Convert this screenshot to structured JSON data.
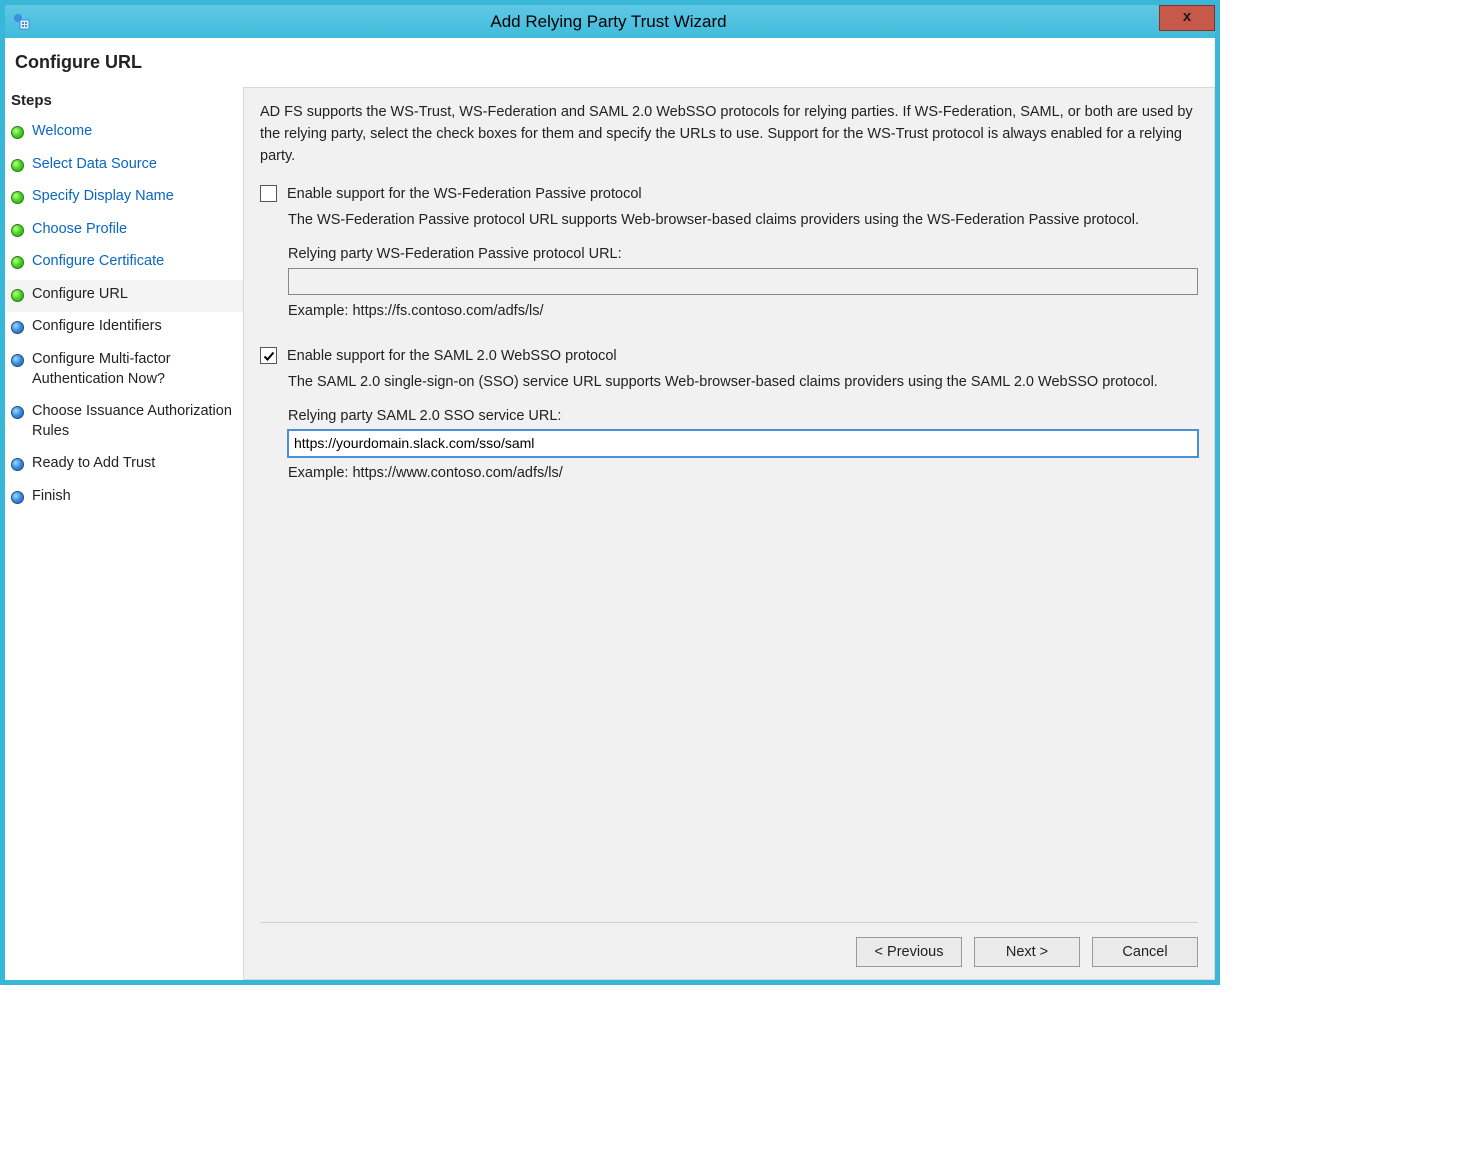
{
  "window": {
    "title": "Add Relying Party Trust Wizard",
    "close_label": "x"
  },
  "page": {
    "title": "Configure URL"
  },
  "sidebar": {
    "heading": "Steps",
    "steps": [
      {
        "label": "Welcome",
        "state": "completed"
      },
      {
        "label": "Select Data Source",
        "state": "completed"
      },
      {
        "label": "Specify Display Name",
        "state": "completed"
      },
      {
        "label": "Choose Profile",
        "state": "completed"
      },
      {
        "label": "Configure Certificate",
        "state": "completed"
      },
      {
        "label": "Configure URL",
        "state": "current"
      },
      {
        "label": "Configure Identifiers",
        "state": "upcoming"
      },
      {
        "label": "Configure Multi-factor Authentication Now?",
        "state": "upcoming"
      },
      {
        "label": "Choose Issuance Authorization Rules",
        "state": "upcoming"
      },
      {
        "label": "Ready to Add Trust",
        "state": "upcoming"
      },
      {
        "label": "Finish",
        "state": "upcoming"
      }
    ]
  },
  "content": {
    "intro": "AD FS supports the WS-Trust, WS-Federation and SAML 2.0 WebSSO protocols for relying parties.  If WS-Federation, SAML, or both are used by the relying party, select the check boxes for them and specify the URLs to use.  Support for the WS-Trust protocol is always enabled for a relying party.",
    "wsfed": {
      "checked": false,
      "label": "Enable support for the WS-Federation Passive protocol",
      "desc": "The WS-Federation Passive protocol URL supports Web-browser-based claims providers using the WS-Federation Passive protocol.",
      "field_label": "Relying party WS-Federation Passive protocol URL:",
      "value": "",
      "example": "Example: https://fs.contoso.com/adfs/ls/"
    },
    "saml": {
      "checked": true,
      "label": "Enable support for the SAML 2.0 WebSSO protocol",
      "desc": "The SAML 2.0 single-sign-on (SSO) service URL supports Web-browser-based claims providers using the SAML 2.0 WebSSO protocol.",
      "field_label": "Relying party SAML 2.0 SSO service URL:",
      "value": "https://yourdomain.slack.com/sso/saml",
      "example": "Example: https://www.contoso.com/adfs/ls/"
    }
  },
  "buttons": {
    "previous": "< Previous",
    "next": "Next >",
    "cancel": "Cancel"
  }
}
